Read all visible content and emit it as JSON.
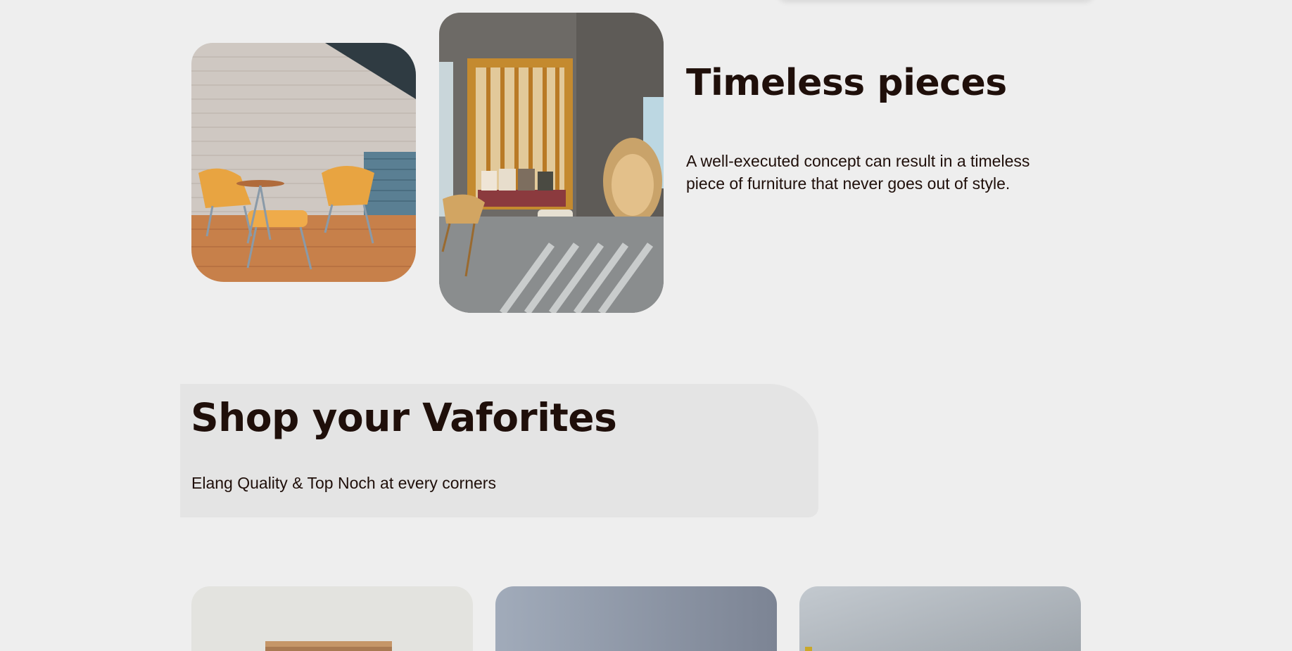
{
  "timeless": {
    "title": "Timeless pieces",
    "description": "A well-executed concept can result in a timeless piece of furniture that never goes out of style."
  },
  "shop": {
    "title": "Shop your Vaforites",
    "subtitle": "Elang Quality & Top Noch at every corners"
  },
  "colors": {
    "background": "#eeeeee",
    "panel": "#e4e4e4",
    "text": "#1f0f0a"
  }
}
